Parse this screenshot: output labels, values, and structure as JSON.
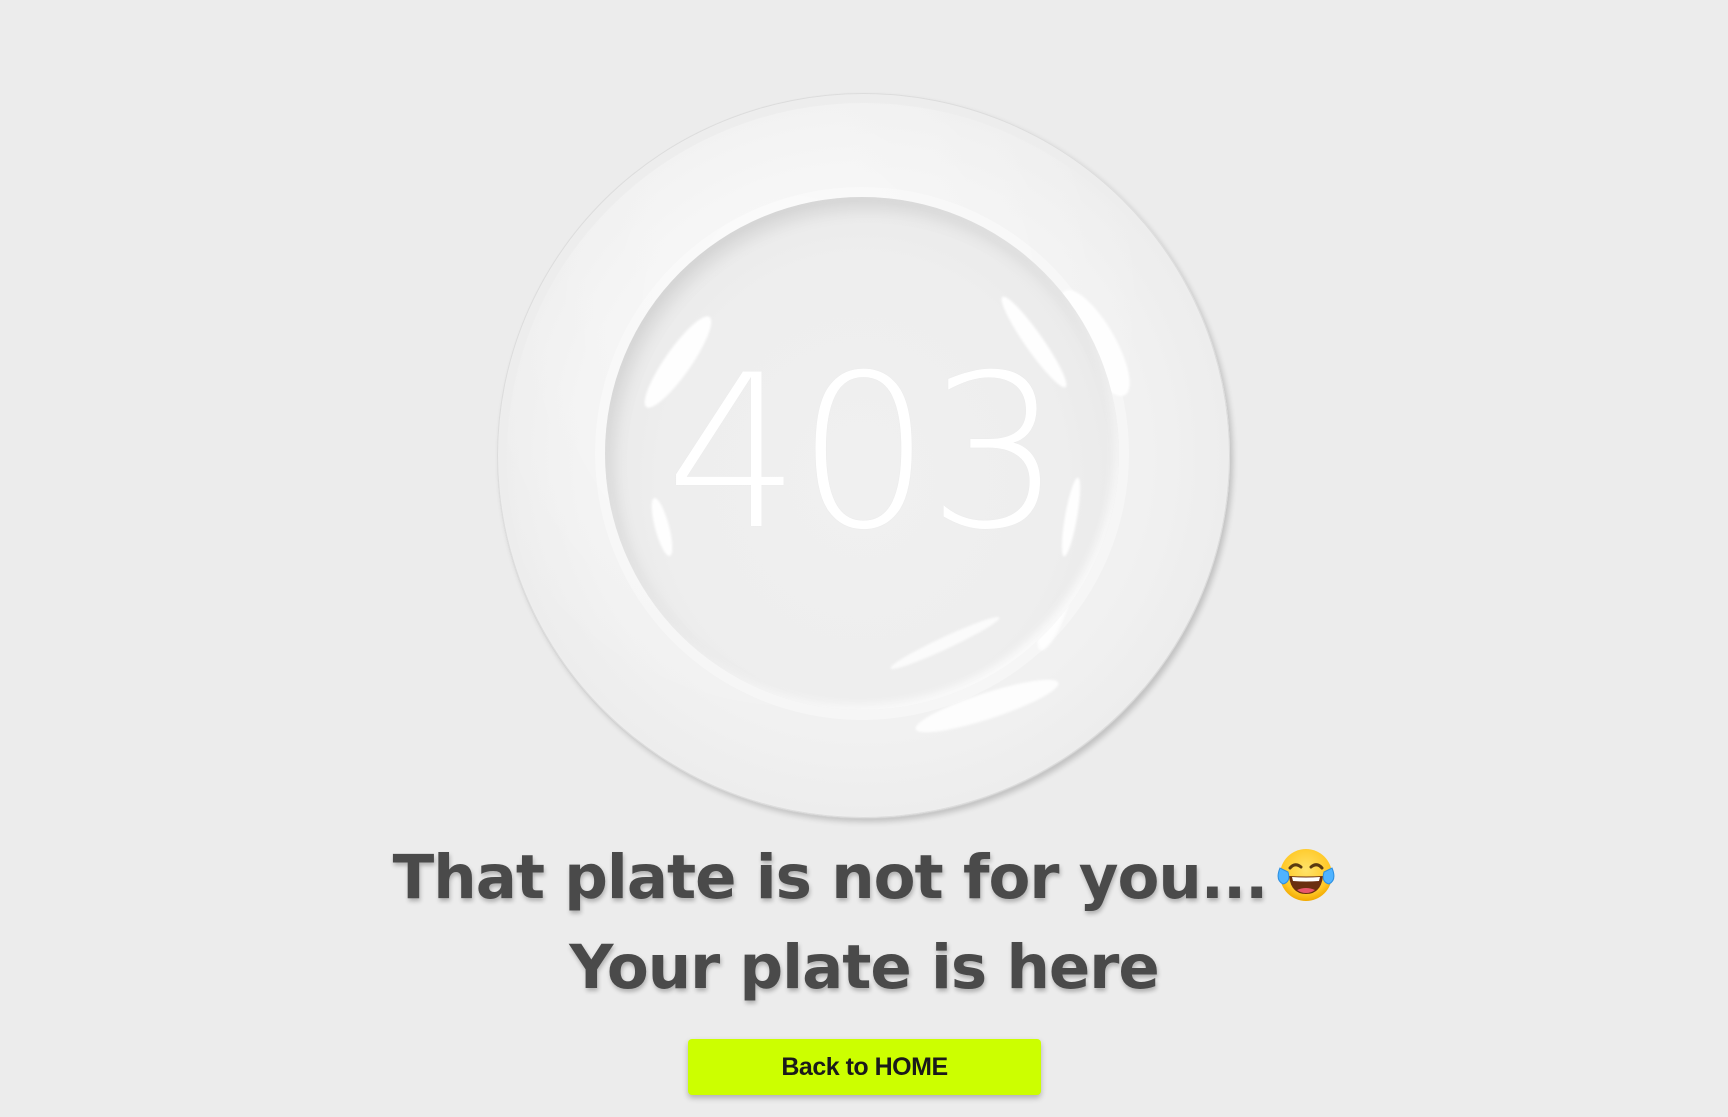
{
  "error": {
    "code": "403"
  },
  "message": {
    "line1": "That plate is not for you...",
    "line1_emoji": "face-with-tears-of-joy",
    "line2": "Your plate is here"
  },
  "actions": {
    "home_label": "Back to HOME"
  },
  "colors": {
    "background": "#ececec",
    "button": "#ccff00",
    "text": "#4a4a4a",
    "code": "#ffffff"
  }
}
